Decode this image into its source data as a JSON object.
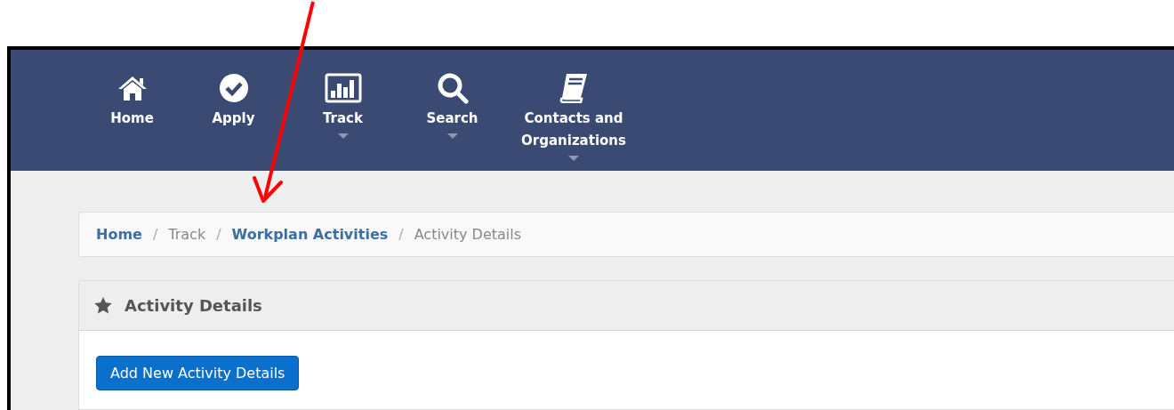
{
  "nav": {
    "items": [
      {
        "label": "Home",
        "dropdown": false
      },
      {
        "label": "Apply",
        "dropdown": false
      },
      {
        "label": "Track",
        "dropdown": true
      },
      {
        "label": "Search",
        "dropdown": true
      },
      {
        "label": "Contacts and Organizations",
        "dropdown": true
      }
    ]
  },
  "breadcrumb": {
    "separator": "/",
    "items": [
      {
        "label": "Home",
        "kind": "link"
      },
      {
        "label": "Track",
        "kind": "text"
      },
      {
        "label": "Workplan Activities",
        "kind": "link"
      },
      {
        "label": "Activity Details",
        "kind": "text"
      }
    ]
  },
  "panel": {
    "title": "Activity Details",
    "button": "Add New Activity Details"
  }
}
